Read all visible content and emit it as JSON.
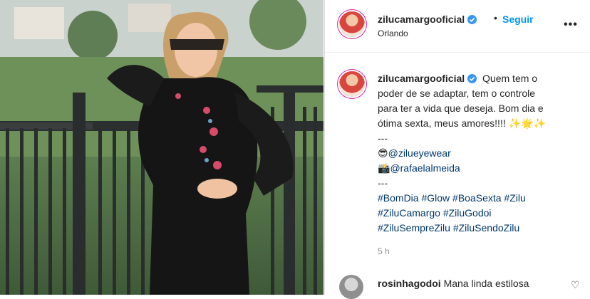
{
  "post": {
    "username": "zilucamargooficial",
    "location": "Orlando",
    "follow_label": "Seguir",
    "separator": "•",
    "more_label": "•••",
    "caption": {
      "line1": "Quem tem o",
      "line2": "poder de se adaptar, tem o controle",
      "line3": "para ter a vida que deseja. Bom dia e",
      "line4": "ótima sexta, meus amores!!!! ✨🌟✨",
      "line5": "---",
      "line6_emoji": "😎",
      "line6_link": "@zilueyewear",
      "line7_emoji": "📸",
      "line7_link": "@rafaelalmeida",
      "line8": "---",
      "hashtags_line1": "#BomDia #Glow #BoaSexta #Zilu",
      "hashtags_line2": "#ZiluCamargo #ZiluGodoi",
      "hashtags_line3": "#ZiluSempreZilu #ZiluSendoZilu"
    },
    "time": "5 h"
  },
  "comment": {
    "username": "rosinhagodoi",
    "text": "Mana linda estilosa",
    "heart": "♡"
  },
  "colors": {
    "link": "#00376b",
    "follow": "#0095f6",
    "verified": "#3897f0"
  }
}
